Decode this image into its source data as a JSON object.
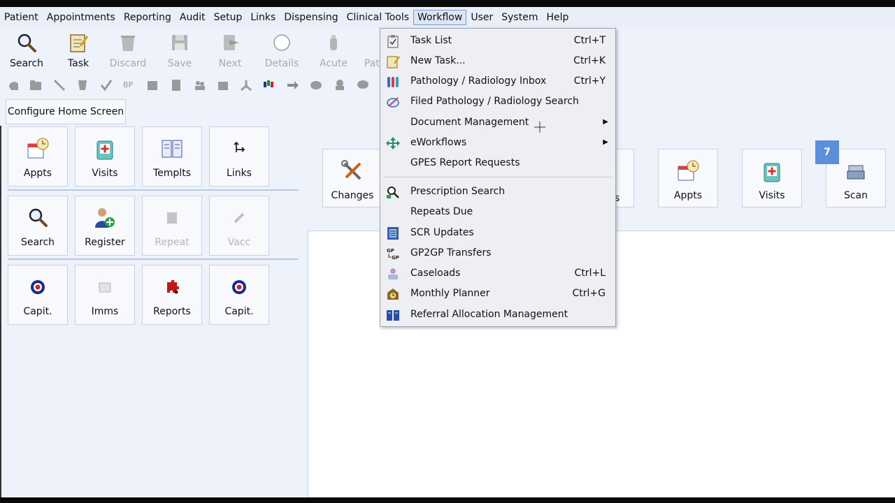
{
  "menubar": [
    "Patient",
    "Appointments",
    "Reporting",
    "Audit",
    "Setup",
    "Links",
    "Dispensing",
    "Clinical Tools",
    "Workflow",
    "User",
    "System",
    "Help"
  ],
  "toolbar": {
    "search": "Search",
    "task": "Task",
    "discard": "Discard",
    "save": "Save",
    "next": "Next",
    "details": "Details",
    "acute": "Acute",
    "pat": "Pat"
  },
  "toolbar2_bp": "BP",
  "configure": "Configure Home Screen",
  "left_tiles": {
    "appts": "Appts",
    "visits": "Visits",
    "templts": "Templts",
    "links": "Links",
    "search": "Search",
    "register": "Register",
    "repeat": "Repeat",
    "vacc": "Vacc",
    "capit1": "Capit.",
    "imms": "Imms",
    "reports": "Reports",
    "capit2": "Capit."
  },
  "right_tiles": {
    "changes": "Changes",
    "partial": "s",
    "appts": "Appts",
    "visits": "Visits",
    "scan": "Scan",
    "badge": "7"
  },
  "workflow_menu": {
    "task_list": {
      "label": "Task List",
      "shortcut": "Ctrl+T"
    },
    "new_task": {
      "label": "New Task...",
      "shortcut": "Ctrl+K"
    },
    "path_inbox": {
      "label": "Pathology / Radiology Inbox",
      "shortcut": "Ctrl+Y"
    },
    "filed_path": {
      "label": "Filed Pathology / Radiology Search"
    },
    "doc_mgmt": {
      "label": "Document Management"
    },
    "eworkflows": {
      "label": "eWorkflows"
    },
    "gpes": {
      "label": "GPES Report Requests"
    },
    "presc_search": {
      "label": "Prescription Search"
    },
    "repeats_due": {
      "label": "Repeats Due"
    },
    "scr_updates": {
      "label": "SCR Updates"
    },
    "gp2gp": {
      "label": "GP2GP Transfers",
      "icon_text": "GP"
    },
    "caseloads": {
      "label": "Caseloads",
      "shortcut": "Ctrl+L"
    },
    "monthly_planner": {
      "label": "Monthly Planner",
      "shortcut": "Ctrl+G"
    },
    "referral": {
      "label": "Referral Allocation Management"
    }
  }
}
